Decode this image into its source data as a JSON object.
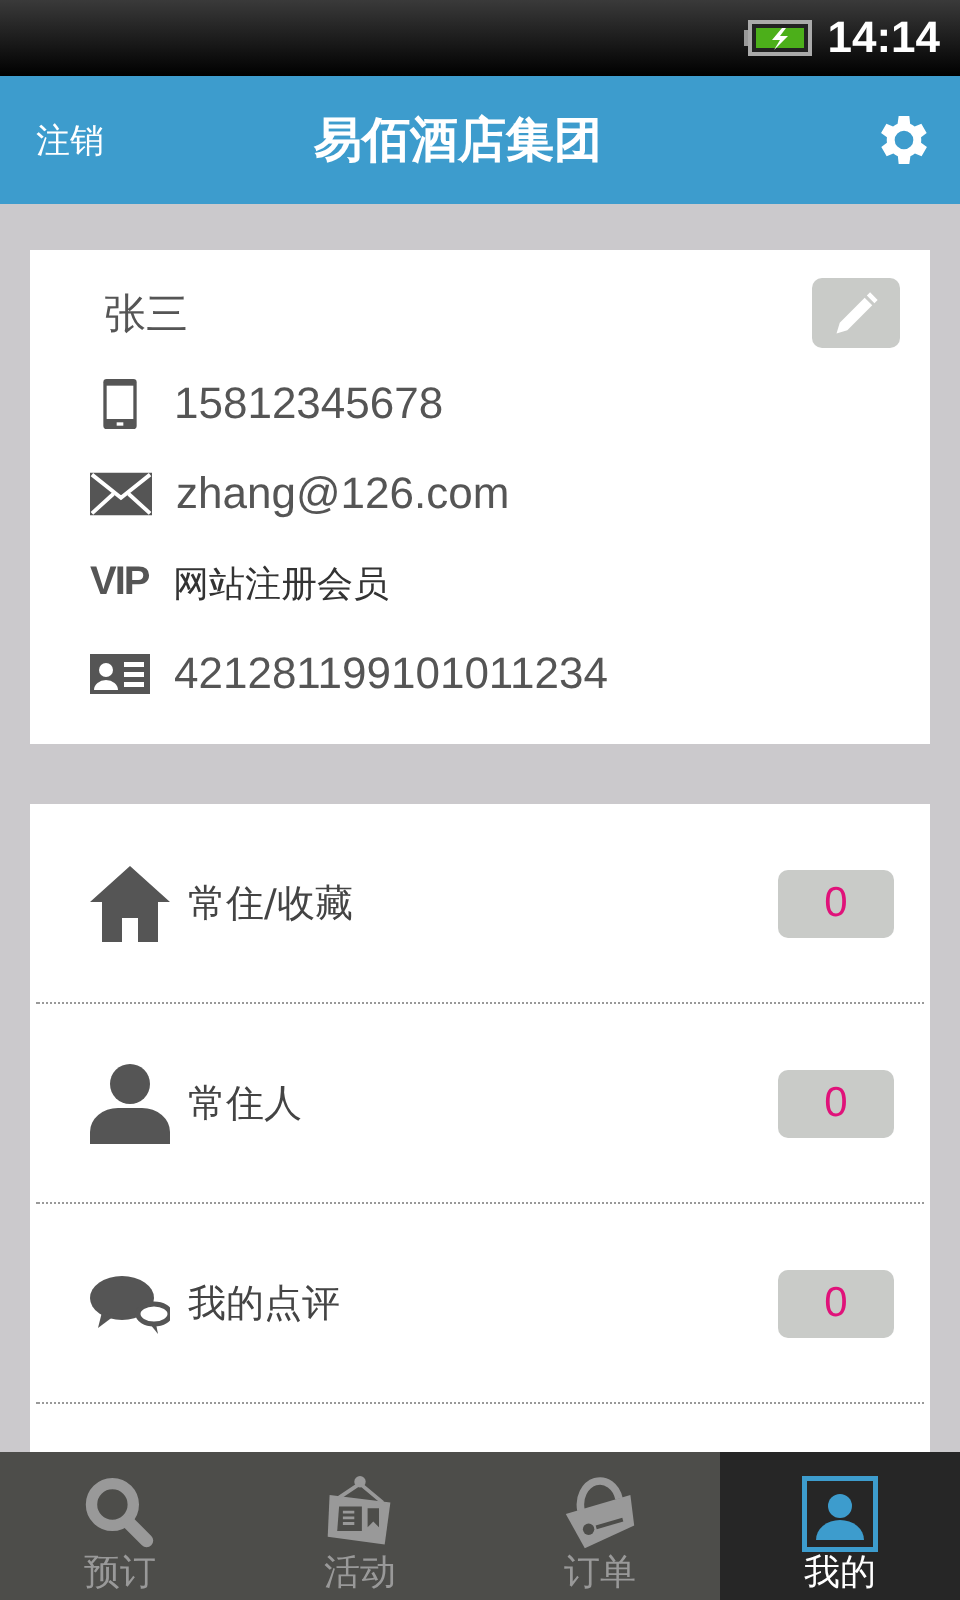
{
  "status_bar": {
    "time": "14:14"
  },
  "header": {
    "left_action": "注销",
    "title": "易佰酒店集团"
  },
  "profile": {
    "name": "张三",
    "details": [
      {
        "kind": "phone",
        "text": "15812345678"
      },
      {
        "kind": "email",
        "text": "zhang@126.com"
      },
      {
        "kind": "vip",
        "badge": "VIP",
        "text": "网站注册会员"
      },
      {
        "kind": "id",
        "text": "421281199101011234"
      }
    ]
  },
  "menu": [
    {
      "kind": "home",
      "label": "常住/收藏",
      "count": "0"
    },
    {
      "kind": "person",
      "label": "常住人",
      "count": "0"
    },
    {
      "kind": "comments",
      "label": "我的点评",
      "count": "0"
    }
  ],
  "tabs": [
    {
      "kind": "search",
      "label": "预订",
      "selected": false
    },
    {
      "kind": "event",
      "label": "活动",
      "selected": false
    },
    {
      "kind": "order",
      "label": "订单",
      "selected": false
    },
    {
      "kind": "mine",
      "label": "我的",
      "selected": true
    }
  ]
}
